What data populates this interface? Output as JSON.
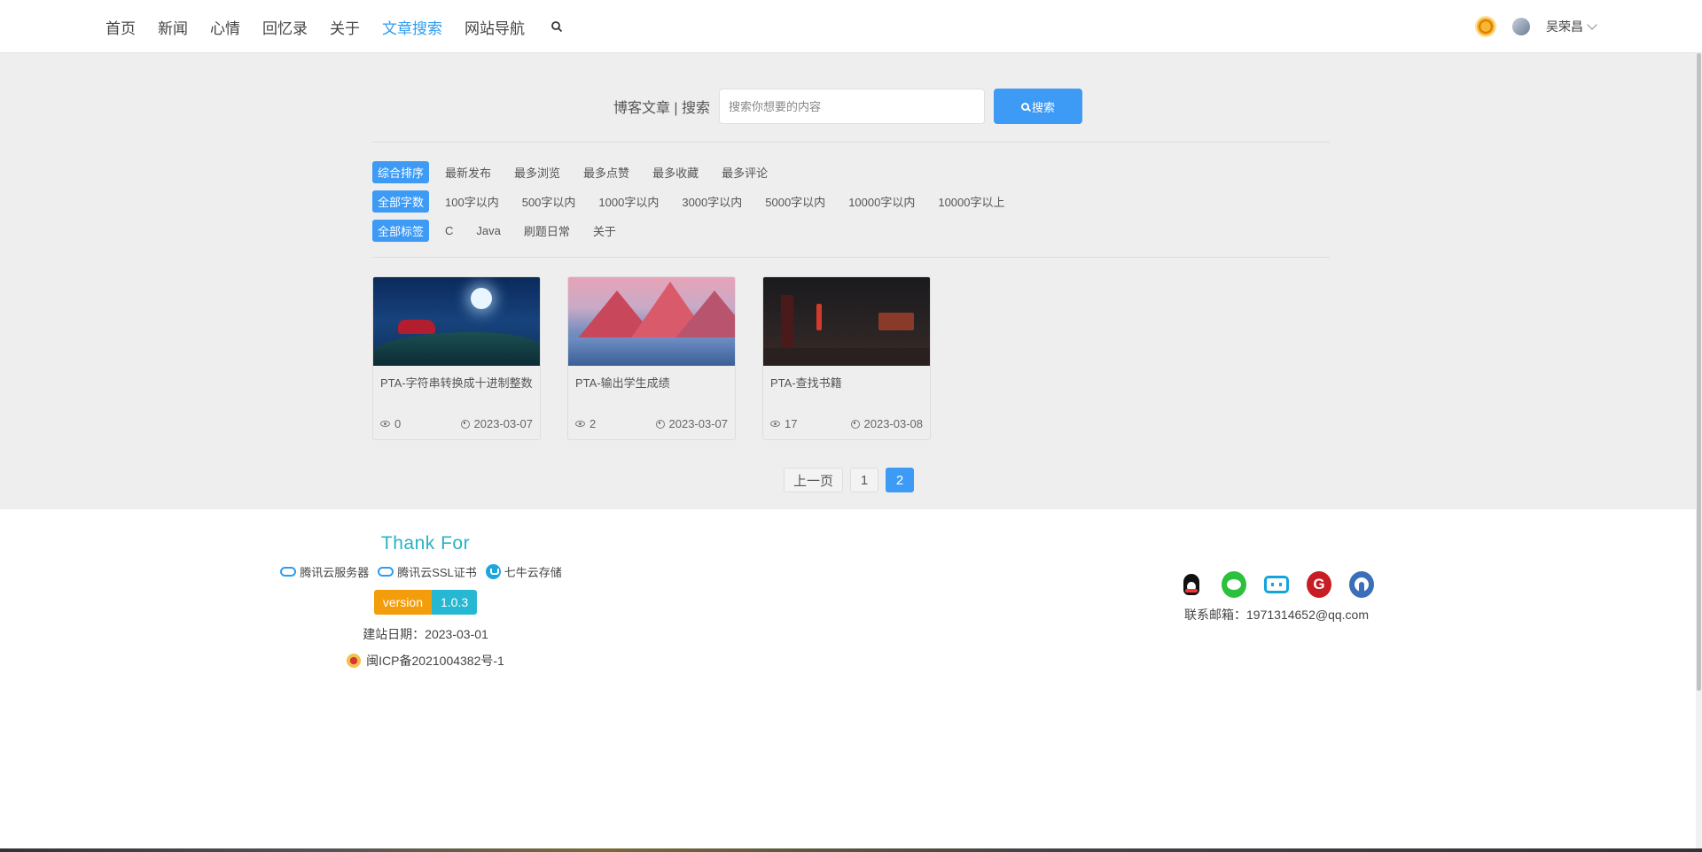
{
  "nav": {
    "items": [
      {
        "label": "首页",
        "active": false
      },
      {
        "label": "新闻",
        "active": false
      },
      {
        "label": "心情",
        "active": false
      },
      {
        "label": "回忆录",
        "active": false
      },
      {
        "label": "关于",
        "active": false
      },
      {
        "label": "文章搜索",
        "active": true
      },
      {
        "label": "网站导航",
        "active": false
      }
    ],
    "search_icon": "search-icon"
  },
  "user": {
    "theme_icon": "sun-icon",
    "name": "吴荣昌"
  },
  "search": {
    "label": "博客文章 | 搜索",
    "placeholder": "搜索你想要的内容",
    "button_label": "搜索"
  },
  "filters": {
    "sort": {
      "active": "综合排序",
      "options": [
        "最新发布",
        "最多浏览",
        "最多点赞",
        "最多收藏",
        "最多评论"
      ]
    },
    "words": {
      "active": "全部字数",
      "options": [
        "100字以内",
        "500字以内",
        "1000字以内",
        "3000字以内",
        "5000字以内",
        "10000字以内",
        "10000字以上"
      ]
    },
    "tags": {
      "active": "全部标签",
      "options": [
        "C",
        "Java",
        "刷题日常",
        "关于"
      ]
    }
  },
  "articles": [
    {
      "title": "PTA-字符串转换成十进制整数",
      "views": "0",
      "date": "2023-03-07"
    },
    {
      "title": "PTA-输出学生成绩",
      "views": "2",
      "date": "2023-03-07"
    },
    {
      "title": "PTA-查找书籍",
      "views": "17",
      "date": "2023-03-08"
    }
  ],
  "pagination": {
    "prev": "上一页",
    "pages": [
      "1",
      "2"
    ],
    "current": "2"
  },
  "footer": {
    "thank_title": "Thank For",
    "sponsors": [
      "腾讯云服务器",
      "腾讯云SSL证书",
      "七牛云存储"
    ],
    "version_label": "version",
    "version_value": "1.0.3",
    "build_date": "建站日期：2023-03-01",
    "icp": "闽ICP备2021004382号-1",
    "social": [
      "qq-icon",
      "wechat-icon",
      "bilibili-icon",
      "gitee-icon",
      "github-icon"
    ],
    "gitee_glyph": "G",
    "email": "联系邮箱：1971314652@qq.com"
  },
  "colors": {
    "accent": "#3d9af5",
    "band": "#efeeee",
    "thank": "#2ab0c8",
    "version_left": "#f49d0c",
    "version_right": "#26b8d2"
  }
}
